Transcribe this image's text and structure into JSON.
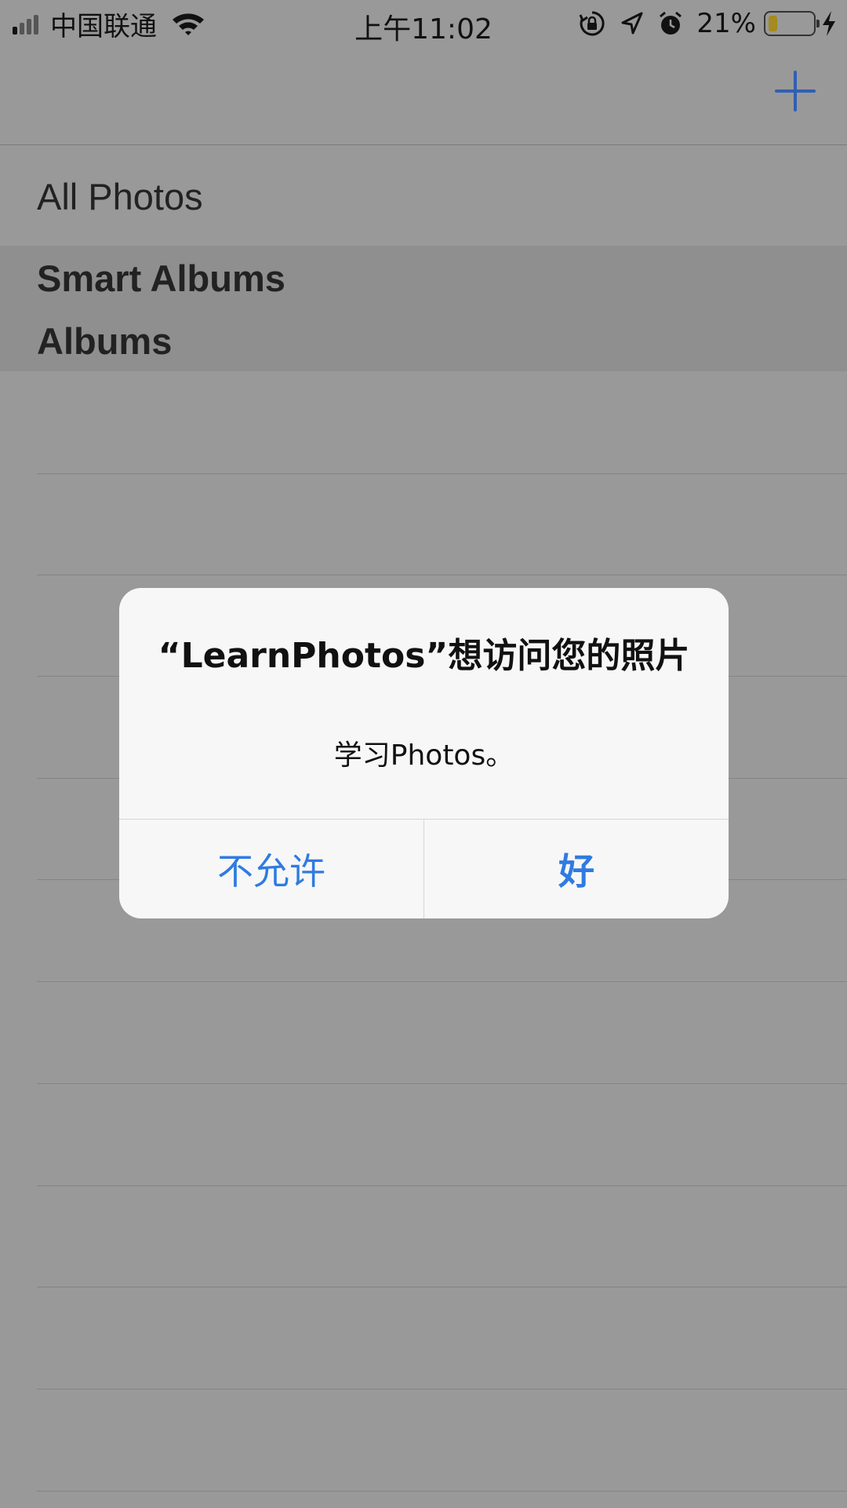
{
  "status_bar": {
    "carrier": "中国联通",
    "time": "上午11:02",
    "battery_percent": "21%",
    "battery_level": 0.21,
    "icons": [
      "signal-icon",
      "wifi-icon",
      "rotation-lock-icon",
      "location-icon",
      "alarm-icon",
      "battery-icon",
      "charging-icon"
    ]
  },
  "nav": {
    "add_icon": "plus-icon",
    "accent_color": "#2f6fd6"
  },
  "list": {
    "all_photos": "All Photos",
    "sections": [
      "Smart Albums",
      "Albums"
    ]
  },
  "alert": {
    "title": "“LearnPhotos”想访问您的照片",
    "message": "学习Photos。",
    "buttons": {
      "deny": "不允许",
      "ok": "好"
    },
    "button_color": "#2f7be0"
  }
}
